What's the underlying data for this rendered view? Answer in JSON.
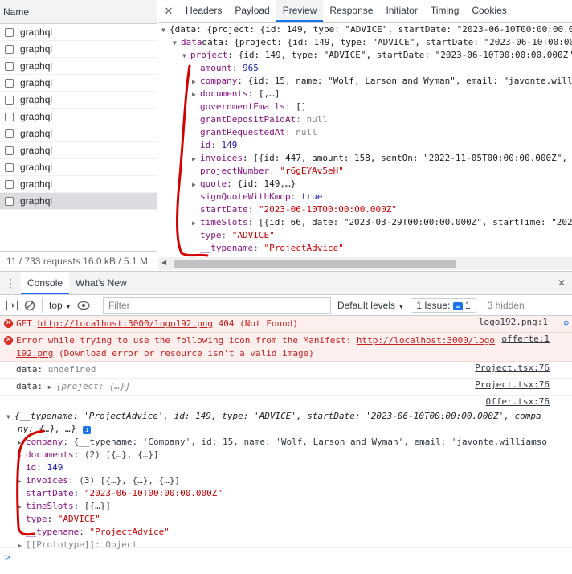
{
  "requests": {
    "header": "Name",
    "items": [
      "graphql",
      "graphql",
      "graphql",
      "graphql",
      "graphql",
      "graphql",
      "graphql",
      "graphql",
      "graphql",
      "graphql",
      "graphql"
    ],
    "footer": "11 / 733 requests   16.0 kB / 5.1 M"
  },
  "detail_tabs": [
    "Headers",
    "Payload",
    "Preview",
    "Response",
    "Initiator",
    "Timing",
    "Cookies"
  ],
  "preview": {
    "l0": "{data: {project: {id: 149, type: \"ADVICE\", startDate: \"2023-06-10T00:00:00.0",
    "l1": "data: {project: {id: 149, type: \"ADVICE\", startDate: \"2023-06-10T00:00:00.0",
    "l2_key": "project",
    "l2_val": ": {id: 149, type: \"ADVICE\", startDate: \"2023-06-10T00:00:00.000Z\", endD",
    "amount_k": "amount",
    "amount_v": "965",
    "company_k": "company",
    "company_v": ": {id: 15, name: \"Wolf, Larson and Wyman\", email: \"javonte.will",
    "documents_k": "documents",
    "documents_v": ": [,…]",
    "gov_k": "governmentEmails",
    "gov_v": ": []",
    "gdp_k": "grantDepositPaidAt",
    "gdp_v": "null",
    "gra_k": "grantRequestedAt",
    "gra_v": "null",
    "id_k": "id",
    "id_v": "149",
    "inv_k": "invoices",
    "inv_v": ": [{id: 447, amount: 158, sentOn: \"2022-11-05T00:00:00.000Z\",",
    "pn_k": "projectNumber",
    "pn_v": "\"r6gEYAv5eH\"",
    "quote_k": "quote",
    "quote_v": ": {id: 149,…}",
    "sqk_k": "signQuoteWithKmop",
    "sqk_v": "true",
    "sd_k": "startDate",
    "sd_v": "\"2023-06-10T00:00:00.000Z\"",
    "ts_k": "timeSlots",
    "ts_v": ": [{id: 66, date: \"2023-03-29T00:00:00.000Z\", startTime: \"202",
    "type_k": "type",
    "type_v": "\"ADVICE\"",
    "tn_k": "__typename",
    "tn_v": "\"ProjectAdvice\""
  },
  "console": {
    "tabs": [
      "Console",
      "What's New"
    ],
    "context": "top",
    "filter_placeholder": "Filter",
    "levels": "Default levels",
    "issues_label": "1 Issue:",
    "issues_count": "1",
    "hidden": "3 hidden",
    "err1_prefix": "GET ",
    "err1_url": "http://localhost:3000/logo192.png",
    "err1_suffix": " 404 (Not Found)",
    "err1_src": "logo192.png:1",
    "err2_text_a": "Error while trying to use the following icon from the Manifest: ",
    "err2_url": "http://localhost:3000/logo",
    "err2_text_b": "192.png",
    "err2_text_c": " (Download error or resource isn't a valid image)",
    "err2_src": "offerte:1",
    "log1_label": "data:",
    "log1_val": "undefined",
    "log1_src": "Project.tsx:76",
    "log2_label": "data:",
    "log2_val": "{project: {…}}",
    "log2_src": "Project.tsx:76",
    "log3_src": "Offer.tsx:76",
    "obj_line1": "{__typename: 'ProjectAdvice', id: 149, type: 'ADVICE', startDate: '2023-06-10T00:00:00.000Z', compa",
    "obj_line2": "ny: {…}, …}",
    "c_company_k": "company",
    "c_company_v": ": {__typename: 'Company', id: 15, name: 'Wolf, Larson and Wyman', email: 'javonte.williamso",
    "c_docs_k": "documents",
    "c_docs_v": ": (2) [{…}, {…}]",
    "c_id_k": "id",
    "c_id_v": "149",
    "c_inv_k": "invoices",
    "c_inv_v": ": (3) [{…}, {…}, {…}]",
    "c_sd_k": "startDate",
    "c_sd_v": "\"2023-06-10T00:00:00.000Z\"",
    "c_ts_k": "timeSlots",
    "c_ts_v": ": [{…}]",
    "c_type_k": "type",
    "c_type_v": "\"ADVICE\"",
    "c_tn_k": "__typename",
    "c_tn_v": "\"ProjectAdvice\"",
    "c_proto": "[[Prototype]]: Object",
    "prompt": ">"
  }
}
